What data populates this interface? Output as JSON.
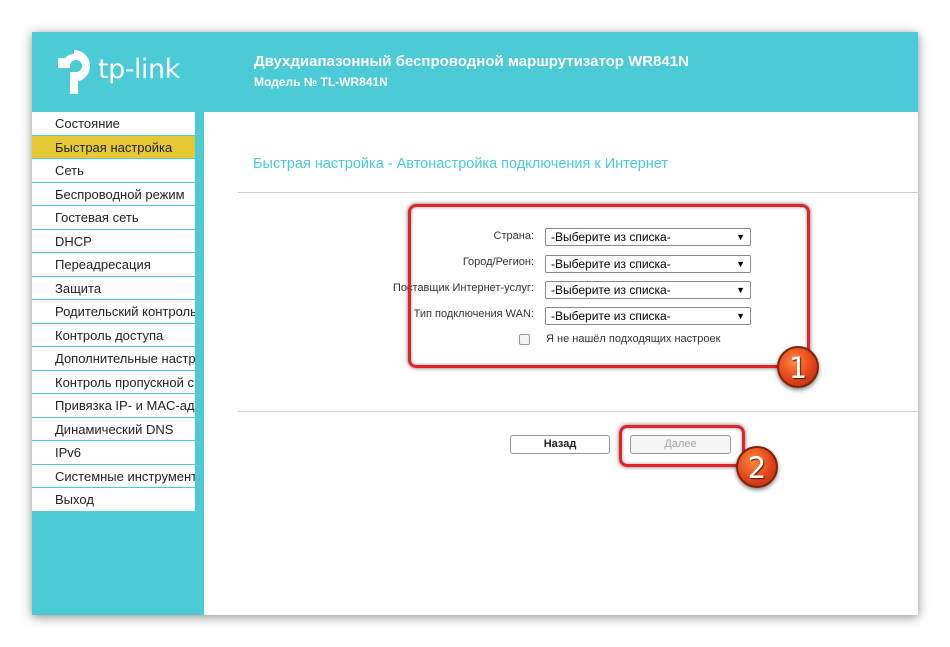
{
  "header": {
    "logo_text": "tp-link",
    "title": "Двухдиапазонный беспроводной маршрутизатор WR841N",
    "model": "Модель № TL-WR841N",
    "color": "#4acbd6"
  },
  "sidebar": {
    "active_color": "#e6c932",
    "items": [
      {
        "label": "Состояние"
      },
      {
        "label": "Быстрая настройка"
      },
      {
        "label": "Сеть"
      },
      {
        "label": "Беспроводной режим"
      },
      {
        "label": "Гостевая сеть"
      },
      {
        "label": "DHCP"
      },
      {
        "label": "Переадресация"
      },
      {
        "label": "Защита"
      },
      {
        "label": "Родительский контроль"
      },
      {
        "label": "Контроль доступа"
      },
      {
        "label": "Дополнительные настройки"
      },
      {
        "label": "Контроль пропускной способности"
      },
      {
        "label": "Привязка IP- и MAC-адресов"
      },
      {
        "label": "Динамический DNS"
      },
      {
        "label": "IPv6"
      },
      {
        "label": "Системные инструменты"
      },
      {
        "label": "Выход"
      }
    ]
  },
  "main": {
    "page_title": "Быстрая настройка - Автонастройка подключения к Интернет",
    "fields": [
      {
        "label": "Страна:",
        "value": "-Выберите из списка-"
      },
      {
        "label": "Город/Регион:",
        "value": "-Выберите из списка-"
      },
      {
        "label": "Поставщик Интернет-услуг:",
        "value": "-Выберите из списка-"
      },
      {
        "label": "Тип подключения WAN:",
        "value": "-Выберите из списка-"
      }
    ],
    "checkbox_label": "Я не нашёл подходящих настроек",
    "back_label": "Назад",
    "next_label": "Далее"
  },
  "annotations": {
    "badge_1": "1",
    "badge_2": "2",
    "highlight_color": "#e3222c"
  }
}
